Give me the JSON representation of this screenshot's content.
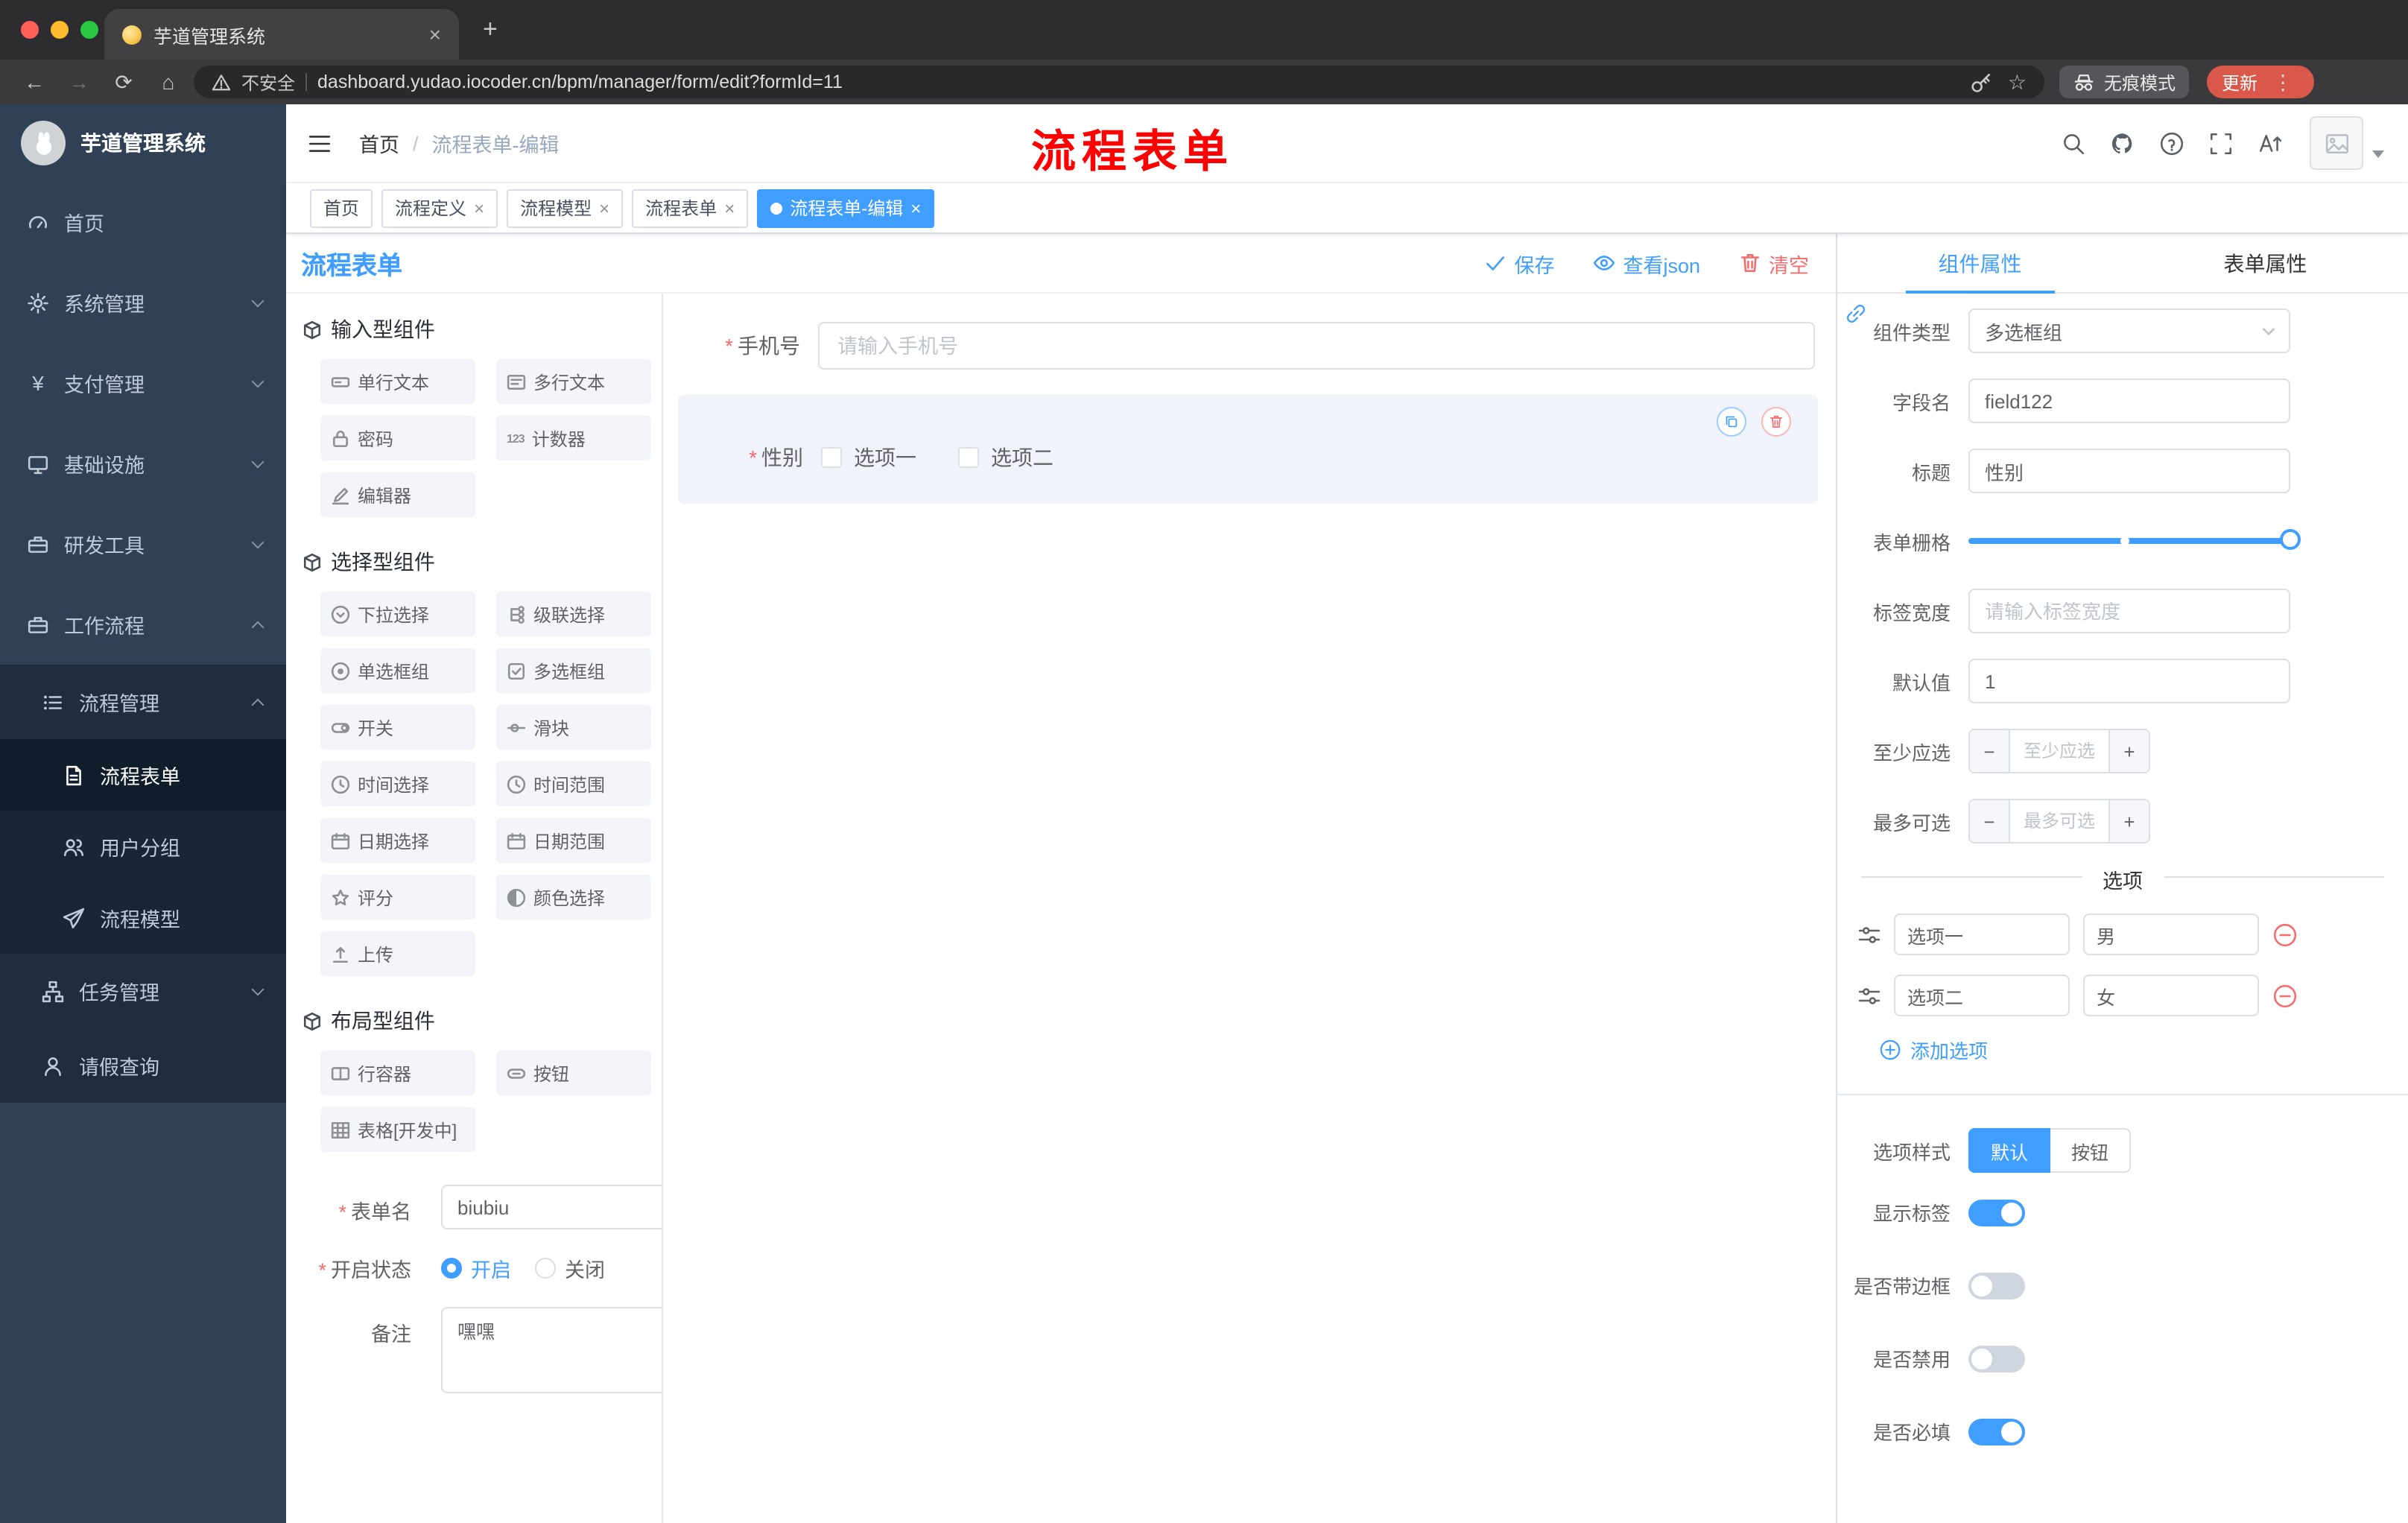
{
  "colors": {
    "accent": "#409eff",
    "danger": "#f56c6c",
    "annotation_red": "#ff0000",
    "sidebar_bg": "#304156"
  },
  "browser": {
    "tab_title": "芋道管理系统",
    "security_label": "不安全",
    "url": "dashboard.yudao.iocoder.cn/bpm/manager/form/edit?formId=11",
    "incognito_label": "无痕模式",
    "update_label": "更新"
  },
  "sidebar": {
    "logo_title": "芋道管理系统",
    "menu": {
      "home": "首页",
      "system": "系统管理",
      "payment": "支付管理",
      "infra": "基础设施",
      "devtools": "研发工具",
      "workflow": "工作流程",
      "process_mgmt": "流程管理",
      "process_form": "流程表单",
      "user_group": "用户分组",
      "process_model": "流程模型",
      "task_mgmt": "任务管理",
      "leave_query": "请假查询"
    }
  },
  "header": {
    "breadcrumb_home": "首页",
    "breadcrumb_current": "流程表单-编辑",
    "annotation": "流程表单"
  },
  "tags_view": {
    "tabs": [
      {
        "label": "首页",
        "closable": false,
        "active": false
      },
      {
        "label": "流程定义",
        "closable": true,
        "active": false
      },
      {
        "label": "流程模型",
        "closable": true,
        "active": false
      },
      {
        "label": "流程表单",
        "closable": true,
        "active": false
      },
      {
        "label": "流程表单-编辑",
        "closable": true,
        "active": true
      }
    ]
  },
  "designer": {
    "title": "流程表单",
    "toolbar": {
      "save": "保存",
      "view_json": "查看json",
      "clear": "清空"
    },
    "groups": [
      {
        "title": "输入型组件",
        "items": [
          {
            "label": "单行文本",
            "icon": "single-line-text"
          },
          {
            "label": "多行文本",
            "icon": "multi-line-text"
          },
          {
            "label": "密码",
            "icon": "password"
          },
          {
            "label": "计数器",
            "icon": "counter"
          },
          {
            "label": "编辑器",
            "icon": "editor"
          }
        ]
      },
      {
        "title": "选择型组件",
        "items": [
          {
            "label": "下拉选择",
            "icon": "select"
          },
          {
            "label": "级联选择",
            "icon": "cascader"
          },
          {
            "label": "单选框组",
            "icon": "radio-group"
          },
          {
            "label": "多选框组",
            "icon": "checkbox-group"
          },
          {
            "label": "开关",
            "icon": "switch"
          },
          {
            "label": "滑块",
            "icon": "slider"
          },
          {
            "label": "时间选择",
            "icon": "time-picker"
          },
          {
            "label": "时间范围",
            "icon": "time-range"
          },
          {
            "label": "日期选择",
            "icon": "date-picker"
          },
          {
            "label": "日期范围",
            "icon": "date-range"
          },
          {
            "label": "评分",
            "icon": "rate"
          },
          {
            "label": "颜色选择",
            "icon": "color-picker"
          },
          {
            "label": "上传",
            "icon": "upload"
          }
        ]
      },
      {
        "title": "布局型组件",
        "items": [
          {
            "label": "行容器",
            "icon": "row-container"
          },
          {
            "label": "按钮",
            "icon": "button"
          },
          {
            "label": "表格[开发中]",
            "icon": "table"
          }
        ]
      }
    ],
    "meta": {
      "name_label": "表单名",
      "name_value": "biubiu",
      "status_label": "开启状态",
      "status_on": "开启",
      "status_off": "关闭",
      "status_selected": "开启",
      "remark_label": "备注",
      "remark_value": "嘿嘿"
    },
    "canvas": {
      "phone": {
        "label": "手机号",
        "placeholder": "请输入手机号"
      },
      "gender": {
        "label": "性别",
        "option1": "选项一",
        "option2": "选项二"
      }
    }
  },
  "props": {
    "tab_component": "组件属性",
    "tab_form": "表单属性",
    "active_tab": "组件属性",
    "component_type_label": "组件类型",
    "component_type_value": "多选框组",
    "field_name_label": "字段名",
    "field_name_value": "field122",
    "title_label": "标题",
    "title_value": "性别",
    "grid_label": "表单栅格",
    "label_width_label": "标签宽度",
    "label_width_placeholder": "请输入标签宽度",
    "default_label": "默认值",
    "default_value": "1",
    "min_label": "至少应选",
    "min_placeholder": "至少应选",
    "max_label": "最多可选",
    "max_placeholder": "最多可选",
    "options_title": "选项",
    "options": [
      {
        "label": "选项一",
        "value": "男"
      },
      {
        "label": "选项二",
        "value": "女"
      }
    ],
    "add_option": "添加选项",
    "style_label": "选项样式",
    "style_default": "默认",
    "style_button": "按钮",
    "style_selected": "默认",
    "switch_show_label": {
      "label": "显示标签",
      "on": true
    },
    "switch_border": {
      "label": "是否带边框",
      "on": false
    },
    "switch_disabled": {
      "label": "是否禁用",
      "on": false
    },
    "switch_required": {
      "label": "是否必填",
      "on": true
    }
  }
}
